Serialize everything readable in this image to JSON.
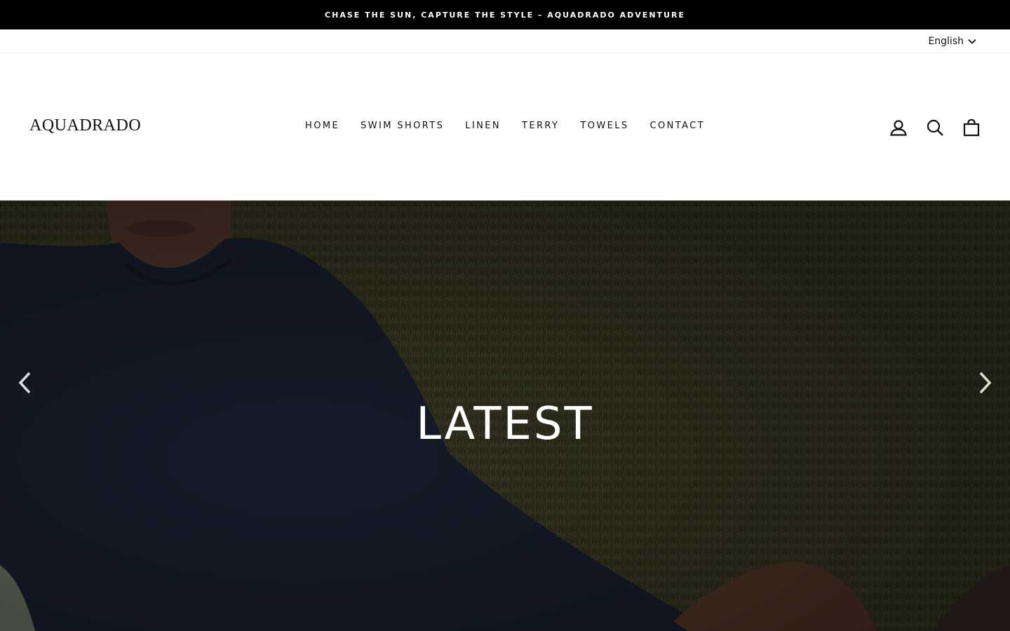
{
  "announcement": {
    "text": "CHASE THE SUN, CAPTURE THE STYLE – AQUADRADO ADVENTURE"
  },
  "utility": {
    "language": "English"
  },
  "header": {
    "logo": "AQUADRADO",
    "nav": [
      "HOME",
      "SWIM SHORTS",
      "LINEN",
      "TERRY",
      "TOWELS",
      "CONTACT"
    ],
    "icons": [
      "account-icon",
      "search-icon",
      "cart-icon"
    ]
  },
  "hero": {
    "title": "LATEST",
    "prev_icon": "chevron-left-icon",
    "next_icon": "chevron-right-icon"
  },
  "colors": {
    "announcement_bg": "#000000",
    "hero_overlay": "#2b2b1c"
  }
}
